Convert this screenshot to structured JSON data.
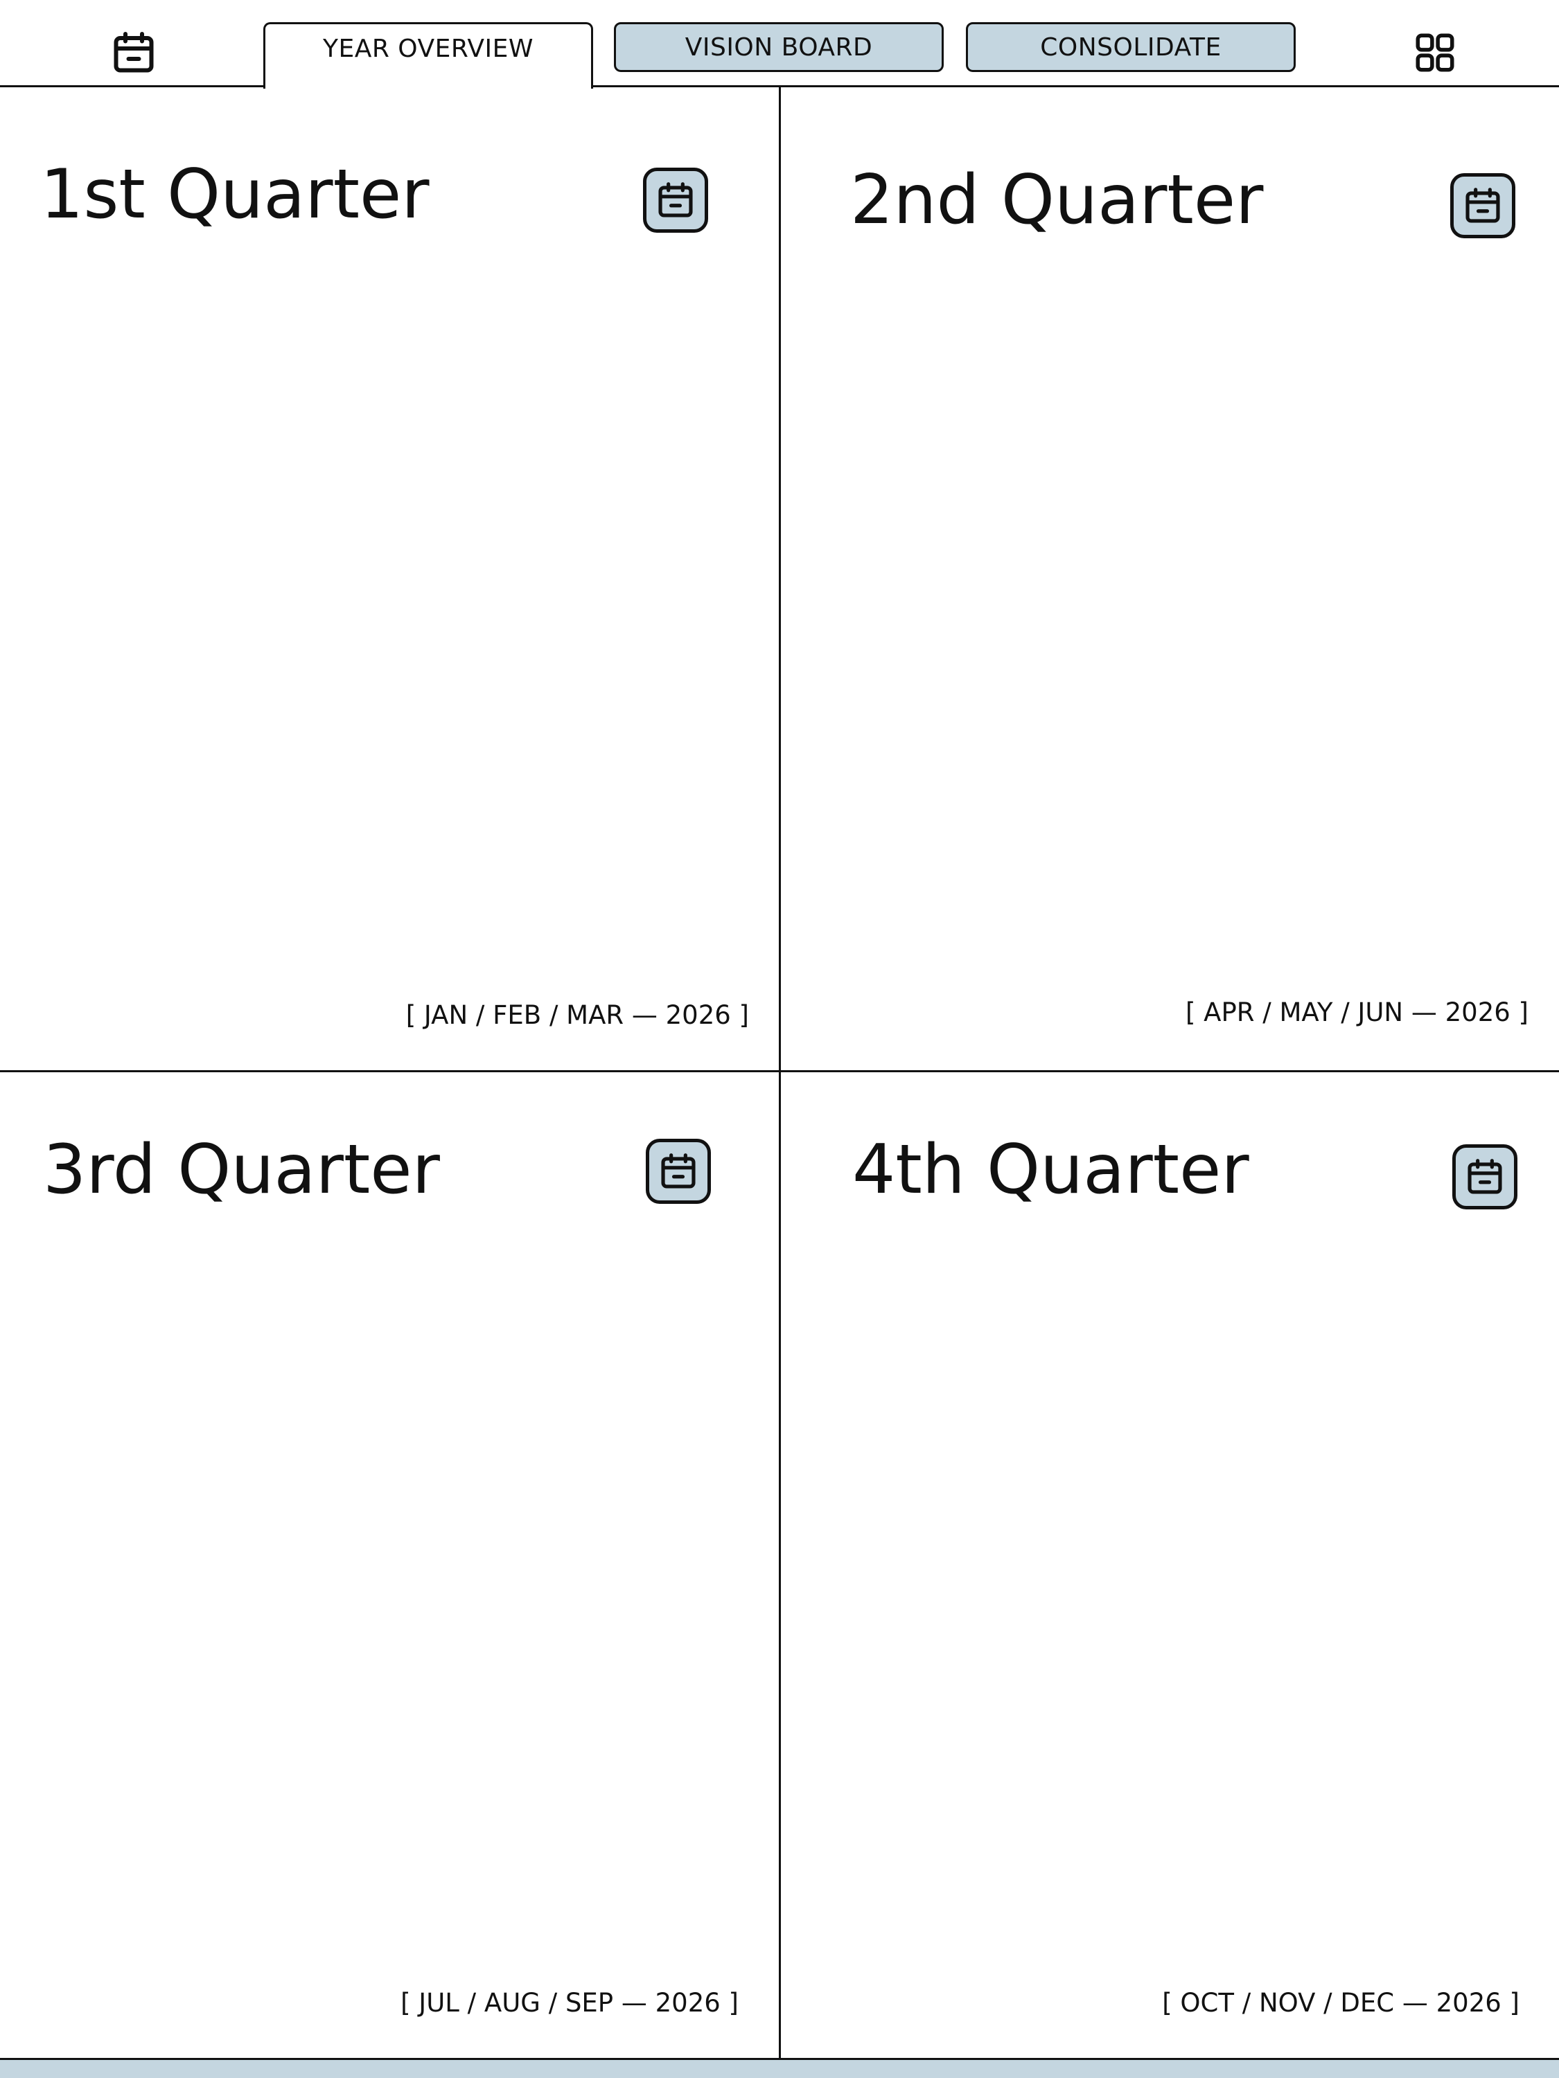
{
  "toolbar": {
    "left_icon": "calendar-icon",
    "right_icon": "grid-icon"
  },
  "tabs": [
    {
      "label": "YEAR OVERVIEW",
      "active": true
    },
    {
      "label": "VISION BOARD",
      "active": false
    },
    {
      "label": "CONSOLIDATE",
      "active": false
    }
  ],
  "quarters": [
    {
      "title": "1st Quarter",
      "months": "[ JAN / FEB / MAR — 2026 ]",
      "icon": "calendar-icon"
    },
    {
      "title": "2nd Quarter",
      "months": "[ APR / MAY / JUN — 2026 ]",
      "icon": "calendar-icon"
    },
    {
      "title": "3rd Quarter",
      "months": "[ JUL / AUG / SEP — 2026 ]",
      "icon": "calendar-icon"
    },
    {
      "title": "4th Quarter",
      "months": "[ OCT / NOV / DEC — 2026 ]",
      "icon": "calendar-icon"
    }
  ],
  "colors": {
    "accent": "#c4d6e0",
    "line": "#111111",
    "background": "#ffffff"
  }
}
